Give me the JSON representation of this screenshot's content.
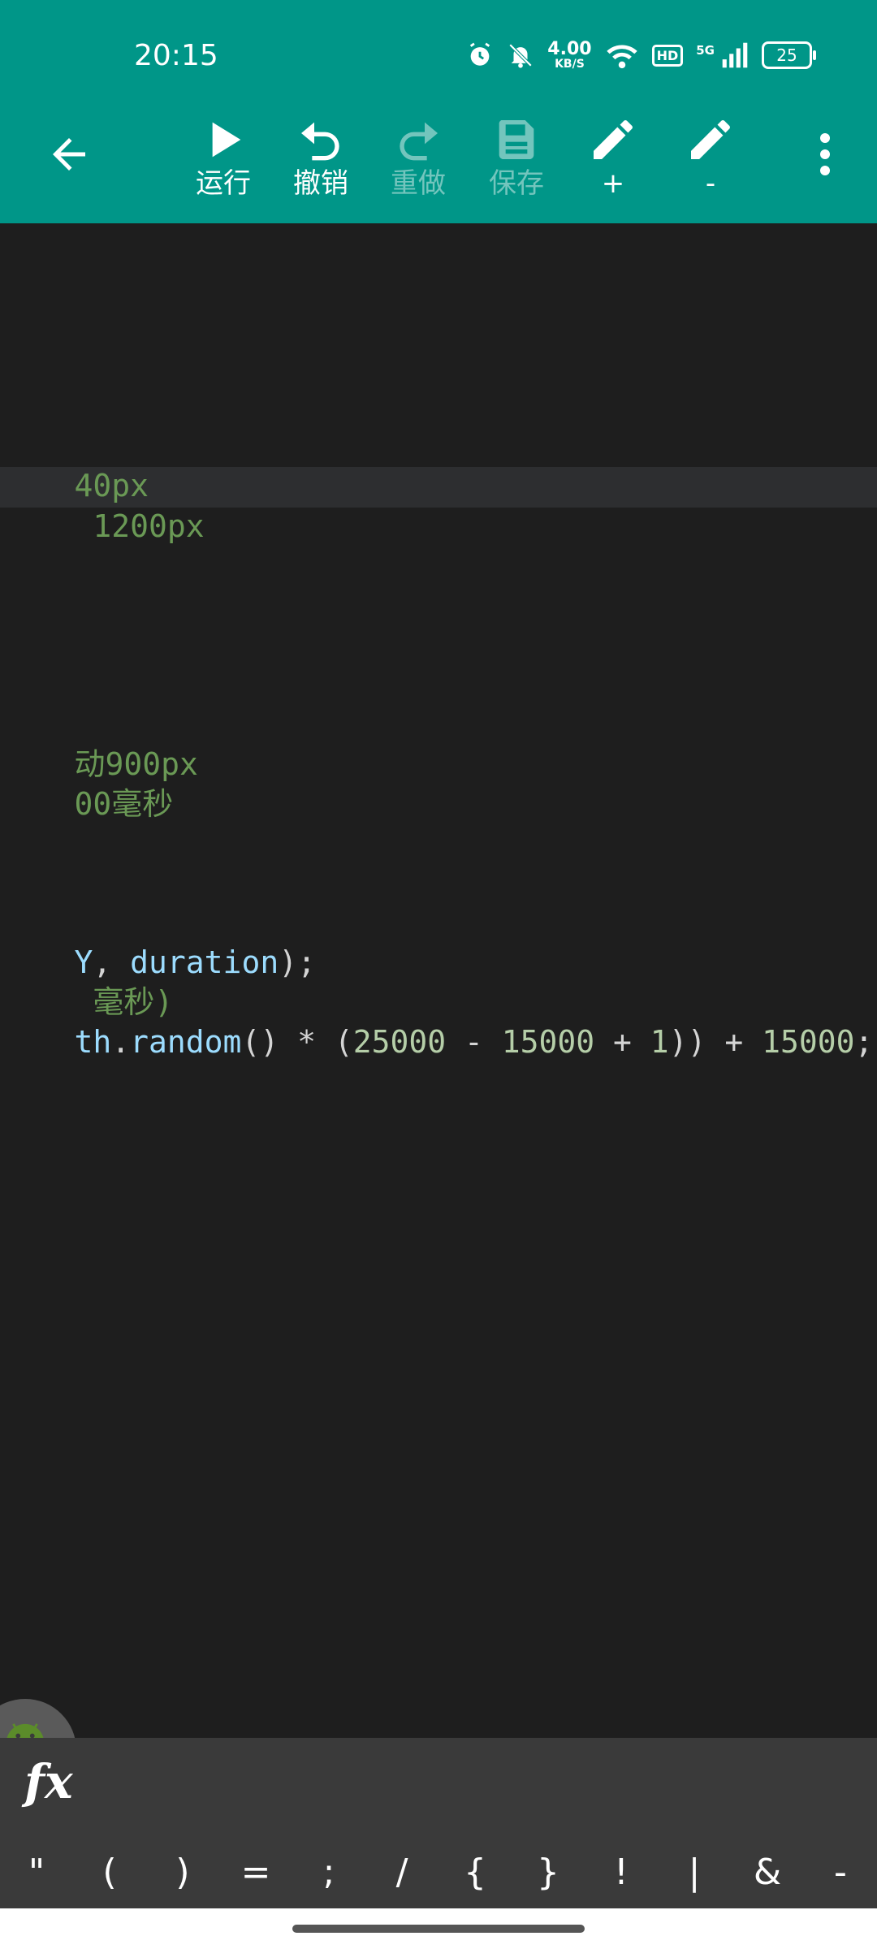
{
  "status_bar": {
    "time": "20:15",
    "net_speed_value": "4.00",
    "net_speed_unit": "KB/S",
    "hd_label": "HD",
    "signal_label": "5G",
    "battery": "25",
    "icons": [
      "alarm-icon",
      "mute-icon",
      "wifi-icon",
      "signal-icon",
      "battery-icon"
    ]
  },
  "toolbar": {
    "back_icon": "arrow-left-icon",
    "items": [
      {
        "label": "运行",
        "icon": "play-icon",
        "enabled": true
      },
      {
        "label": "撤销",
        "icon": "undo-icon",
        "enabled": true
      },
      {
        "label": "重做",
        "icon": "redo-icon",
        "enabled": false
      },
      {
        "label": "保存",
        "icon": "save-icon",
        "enabled": false
      },
      {
        "label": "+",
        "icon": "pencil-icon",
        "enabled": true
      },
      {
        "label": "-",
        "icon": "pencil-icon",
        "enabled": true
      }
    ],
    "menu_icon": "more-vert-icon"
  },
  "editor": {
    "lines": [
      {
        "segments": [
          "40px"
        ]
      },
      {
        "segments": [
          " 1200px"
        ],
        "highlighted": true
      },
      {
        "segments": [
          "动900px"
        ]
      },
      {
        "segments": [
          "00毫秒"
        ]
      },
      {
        "segments": [
          "Y",
          ", ",
          "duration",
          ");"
        ]
      },
      {
        "segments": [
          " 毫秒)"
        ]
      },
      {
        "segments": [
          "th",
          ".",
          "random",
          "() * (",
          "25000",
          " - ",
          "15000",
          " + ",
          "1",
          ")) + ",
          "15000",
          ";"
        ]
      }
    ]
  },
  "fab_icon": "android-js-icon",
  "fx_bar": {
    "label": "fx"
  },
  "symbols": [
    "\"",
    "(",
    ")",
    "=",
    ";",
    "/",
    "{",
    "}",
    "!",
    "|",
    "&",
    "-"
  ],
  "colors": {
    "header": "#009688",
    "editor_bg": "#1e1e1e",
    "comment": "#6a9955",
    "identifier": "#9cdcfe",
    "number": "#b5cea8"
  }
}
